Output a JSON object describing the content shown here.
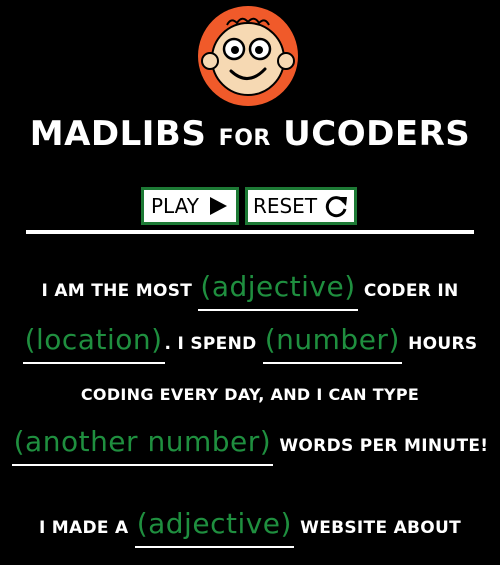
{
  "header": {
    "title_part1": "MADLIBS ",
    "title_small": "FOR",
    "title_part2": " UCODERS"
  },
  "buttons": {
    "play": "PLAY",
    "reset": "RESET"
  },
  "story": {
    "line1_text": "I AM THE MOST",
    "blank1": "(adjective)",
    "line1_end": "CODER IN",
    "blank2": "(location)",
    "line2_mid": ". I SPEND",
    "blank3": "(number)",
    "line2_end": "HOURS",
    "line3": "CODING EVERY DAY, AND I CAN TYPE",
    "blank4": "(another number)",
    "line4_end": "WORDS PER MINUTE!",
    "line5_text": "I MADE A",
    "blank5": "(adjective)",
    "line5_end": "WEBSITE ABOUT"
  },
  "colors": {
    "background": "#000000",
    "accent_green": "#1f8f3f",
    "button_border": "#1d7a35",
    "logo_orange": "#f05a2a"
  }
}
